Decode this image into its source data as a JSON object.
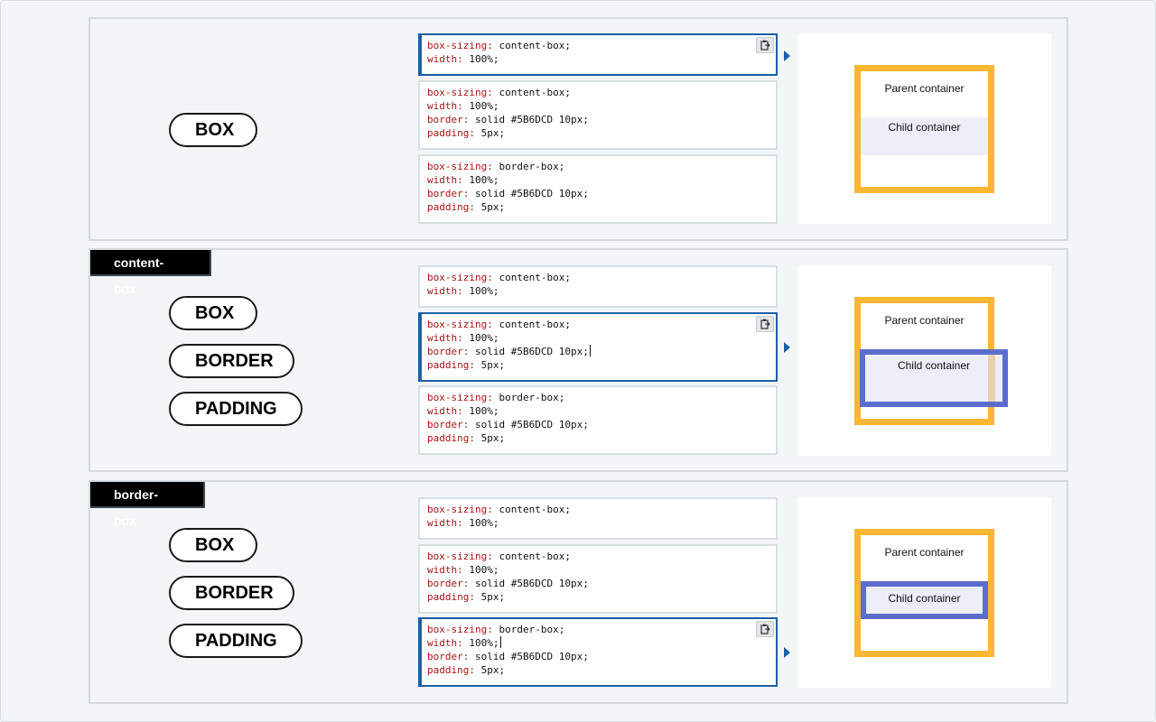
{
  "sections": [
    {
      "tag": "",
      "pills": [
        "BOX"
      ],
      "code_blocks": [
        [
          [
            "box-sizing:",
            " content-box;"
          ],
          [
            "width:",
            " 100%;"
          ]
        ],
        [
          [
            "box-sizing:",
            " content-box;"
          ],
          [
            "width:",
            " 100%;"
          ],
          [
            "border:",
            " solid #5B6DCD 10px;"
          ],
          [
            "padding:",
            " 5px;"
          ]
        ],
        [
          [
            "box-sizing:",
            " border-box;"
          ],
          [
            "width:",
            " 100%;"
          ],
          [
            "border:",
            " solid #5B6DCD 10px;"
          ],
          [
            "padding:",
            " 5px;"
          ]
        ]
      ],
      "active_block": 0,
      "preview": {
        "parent_label": "Parent container",
        "child_label": "Child container"
      }
    },
    {
      "tag": "content-box",
      "pills": [
        "BOX",
        "BORDER",
        "PADDING"
      ],
      "code_blocks": [
        [
          [
            "box-sizing:",
            " content-box;"
          ],
          [
            "width:",
            " 100%;"
          ]
        ],
        [
          [
            "box-sizing:",
            " content-box;"
          ],
          [
            "width:",
            " 100%;"
          ],
          [
            "border:",
            " solid #5B6DCD 10px;"
          ],
          [
            "padding:",
            " 5px;"
          ]
        ],
        [
          [
            "box-sizing:",
            " border-box;"
          ],
          [
            "width:",
            " 100%;"
          ],
          [
            "border:",
            " solid #5B6DCD 10px;"
          ],
          [
            "padding:",
            " 5px;"
          ]
        ]
      ],
      "active_block": 1,
      "preview": {
        "parent_label": "Parent container",
        "child_label": "Child container"
      }
    },
    {
      "tag": "border-box",
      "pills": [
        "BOX",
        "BORDER",
        "PADDING"
      ],
      "code_blocks": [
        [
          [
            "box-sizing:",
            " content-box;"
          ],
          [
            "width:",
            " 100%;"
          ]
        ],
        [
          [
            "box-sizing:",
            " content-box;"
          ],
          [
            "width:",
            " 100%;"
          ],
          [
            "border:",
            " solid #5B6DCD 10px;"
          ],
          [
            "padding:",
            " 5px;"
          ]
        ],
        [
          [
            "box-sizing:",
            " border-box;"
          ],
          [
            "width:",
            " 100%;"
          ],
          [
            "border:",
            " solid #5B6DCD 10px;"
          ],
          [
            "padding:",
            " 5px;"
          ]
        ]
      ],
      "active_block": 2,
      "preview": {
        "parent_label": "Parent container",
        "child_label": "Child container"
      }
    }
  ],
  "colors": {
    "parent_border": "#fbb731",
    "child_border": "#5b6dcd",
    "child_fill": "#eceef9",
    "active_accent": "#1c5fa6",
    "css_property": "#a31515"
  },
  "icons": {
    "copy": "clipboard-copy-icon",
    "run_arrow": "play-arrow-icon"
  }
}
